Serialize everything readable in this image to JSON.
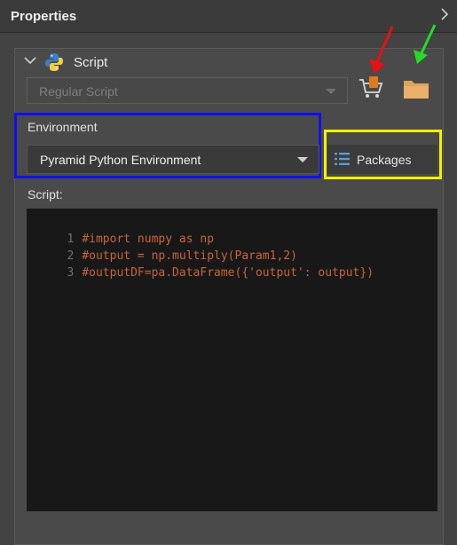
{
  "panel": {
    "title": "Properties",
    "expand_icon": "chevron-right-icon"
  },
  "section": {
    "title": "Script",
    "icon": "python-icon",
    "collapse_icon": "chevron-down-icon"
  },
  "script_type": {
    "value": "Regular Script",
    "disabled": true
  },
  "toolbar": {
    "cart_icon": "cart-icon",
    "folder_icon": "folder-icon"
  },
  "environment": {
    "label": "Environment",
    "value": "Pyramid Python Environment"
  },
  "packages": {
    "label": "Packages",
    "icon": "list-icon"
  },
  "script": {
    "label": "Script:",
    "lines": [
      {
        "num": "1",
        "text": "#import numpy as np"
      },
      {
        "num": "2",
        "text": "#output = np.multiply(Param1,2)"
      },
      {
        "num": "3",
        "text": "#outputDF=pa.DataFrame({'output': output})"
      }
    ]
  },
  "annotations": {
    "colors": {
      "red_arrow": "#e81010",
      "green_arrow": "#22dd22",
      "blue_box": "#1010ee",
      "yellow_box": "#f2f200"
    }
  },
  "colors": {
    "code_comment": "#c8643c",
    "cart_orange": "#e07a1e",
    "folder": "#e0a35a"
  }
}
